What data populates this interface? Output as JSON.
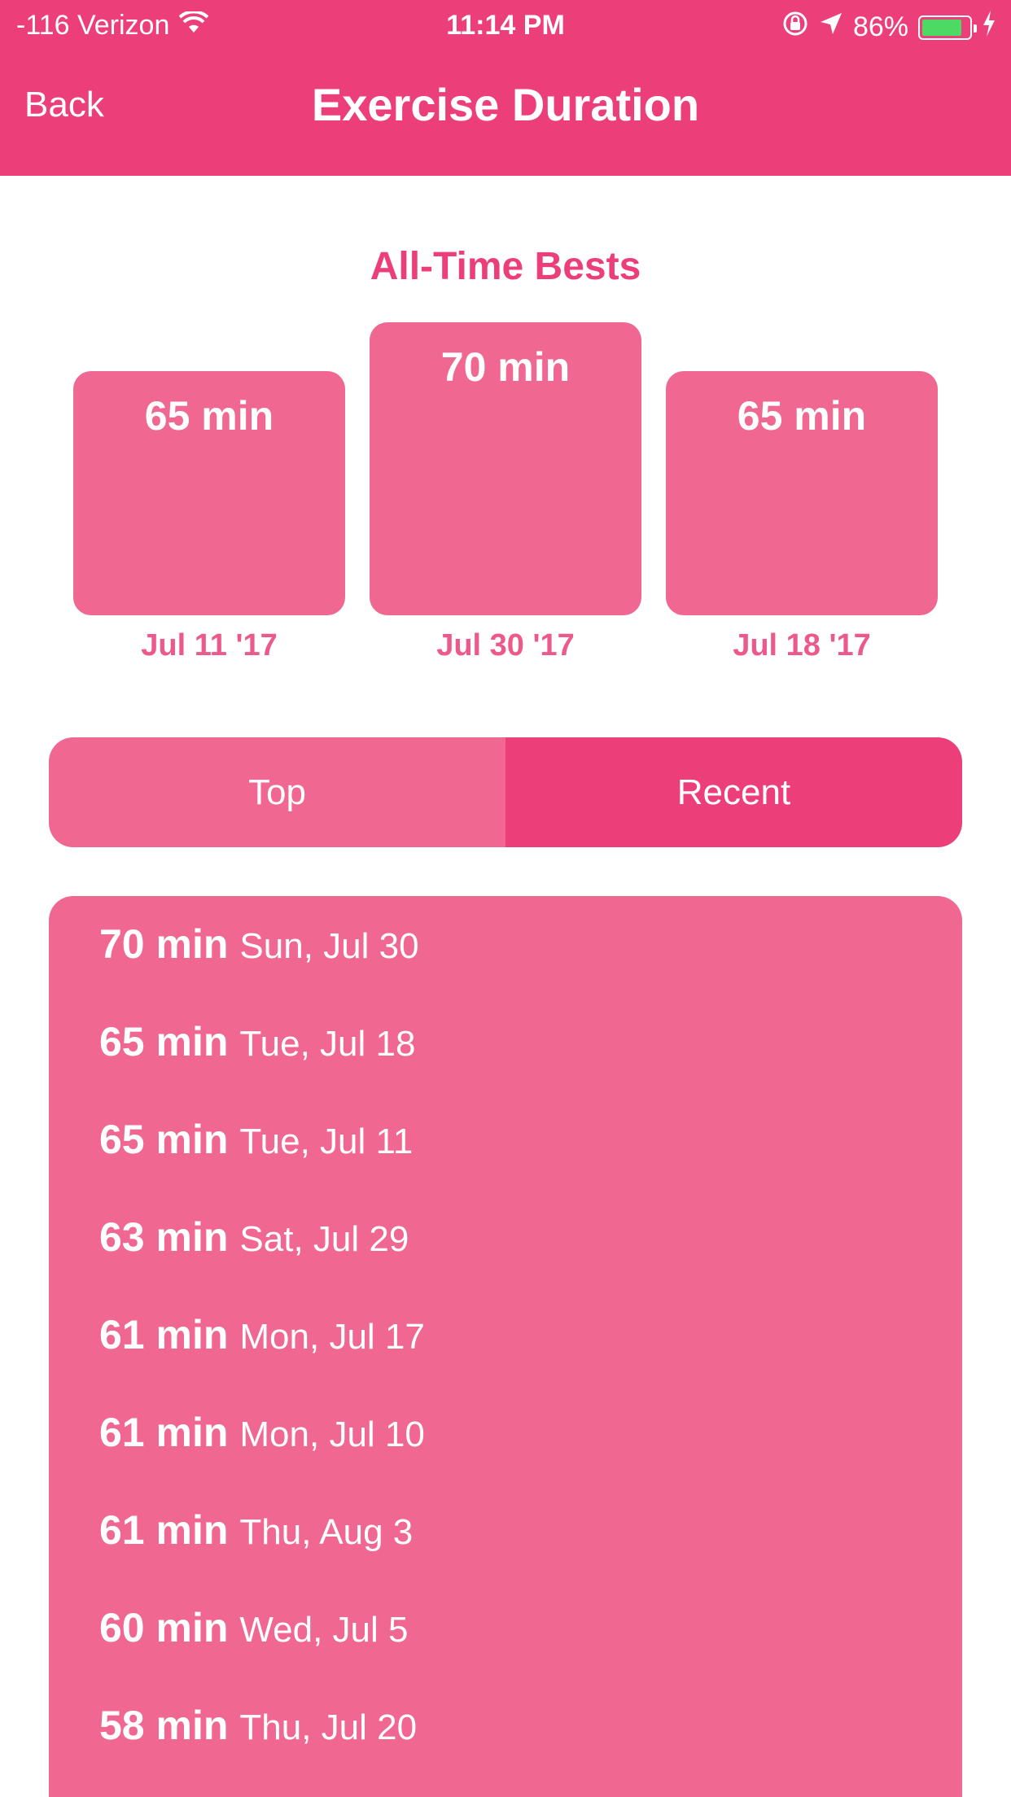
{
  "status_bar": {
    "carrier": "-116 Verizon",
    "time": "11:14 PM",
    "battery_percent": "86%",
    "battery_level": 0.86,
    "battery_color": "#4cd964"
  },
  "nav": {
    "back_label": "Back",
    "title": "Exercise Duration"
  },
  "bests": {
    "title": "All-Time Bests",
    "items": [
      {
        "value": "65 min",
        "date": "Jul 11 '17"
      },
      {
        "value": "70 min",
        "date": "Jul 30 '17"
      },
      {
        "value": "65 min",
        "date": "Jul 18 '17"
      }
    ]
  },
  "segments": {
    "top_label": "Top",
    "recent_label": "Recent",
    "selected": "Recent"
  },
  "list": {
    "items": [
      {
        "value": "70 min",
        "date": "Sun, Jul 30"
      },
      {
        "value": "65 min",
        "date": "Tue, Jul 18"
      },
      {
        "value": "65 min",
        "date": "Tue, Jul 11"
      },
      {
        "value": "63 min",
        "date": "Sat, Jul 29"
      },
      {
        "value": "61 min",
        "date": "Mon, Jul 17"
      },
      {
        "value": "61 min",
        "date": "Mon, Jul 10"
      },
      {
        "value": "61 min",
        "date": "Thu, Aug 3"
      },
      {
        "value": "60 min",
        "date": "Wed, Jul 5"
      },
      {
        "value": "58 min",
        "date": "Thu, Jul 20"
      }
    ]
  },
  "colors": {
    "accent": "#ec3f79",
    "card": "#f06792"
  }
}
